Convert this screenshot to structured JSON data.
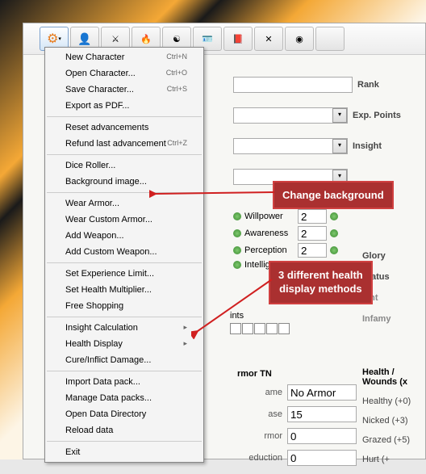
{
  "toolbar": {
    "icons": [
      "gear",
      "char",
      "sword",
      "fire",
      "yinyang",
      "id",
      "ribbon",
      "cross",
      "disc",
      "blank"
    ]
  },
  "menu": {
    "g1": [
      {
        "l": "New Character",
        "s": "Ctrl+N"
      },
      {
        "l": "Open Character...",
        "s": "Ctrl+O"
      },
      {
        "l": "Save Character...",
        "s": "Ctrl+S"
      },
      {
        "l": "Export as PDF...",
        "s": ""
      }
    ],
    "g2": [
      {
        "l": "Reset advancements",
        "s": ""
      },
      {
        "l": "Refund last advancement",
        "s": "Ctrl+Z"
      }
    ],
    "g3": [
      {
        "l": "Dice Roller...",
        "s": ""
      },
      {
        "l": "Background image...",
        "s": ""
      }
    ],
    "g4": [
      {
        "l": "Wear Armor...",
        "s": ""
      },
      {
        "l": "Wear Custom Armor...",
        "s": ""
      },
      {
        "l": "Add Weapon...",
        "s": ""
      },
      {
        "l": "Add Custom Weapon...",
        "s": ""
      }
    ],
    "g5": [
      {
        "l": "Set Experience Limit...",
        "s": ""
      },
      {
        "l": "Set Health Multiplier...",
        "s": ""
      },
      {
        "l": "Free Shopping",
        "s": ""
      }
    ],
    "g6": [
      {
        "l": "Insight Calculation",
        "s": "▸"
      },
      {
        "l": "Health Display",
        "s": "▸"
      },
      {
        "l": "Cure/Inflict Damage...",
        "s": ""
      }
    ],
    "g7": [
      {
        "l": "Import Data pack...",
        "s": ""
      },
      {
        "l": "Manage Data packs...",
        "s": ""
      },
      {
        "l": "Open Data Directory",
        "s": ""
      },
      {
        "l": "Reload data",
        "s": ""
      }
    ],
    "g8": [
      {
        "l": "Exit",
        "s": ""
      }
    ]
  },
  "right": {
    "rank": "Rank",
    "exp": "Exp. Points",
    "insight": "Insight"
  },
  "stats": [
    {
      "n": "Willpower",
      "v": "2"
    },
    {
      "n": "Awareness",
      "v": "2"
    },
    {
      "n": "Perception",
      "v": "2"
    },
    {
      "n": "Intelliger",
      "v": ""
    }
  ],
  "side": {
    "glory": "Glory",
    "status": "Status",
    "taint": "aint",
    "infamy": "Infamy"
  },
  "pts": "ints",
  "armor": {
    "hdr": "rmor TN",
    "name_l": "ame",
    "name_v": "No Armor",
    "base_l": "ase",
    "base_v": "15",
    "armor_l": "rmor",
    "armor_v": "0",
    "red_l": "eduction",
    "red_v": "0"
  },
  "health": {
    "hdr": "Health / Wounds (x",
    "h1": "Healthy (+0)",
    "h2": "Nicked (+3)",
    "h3": "Grazed (+5)",
    "h4": "Hurt (+"
  },
  "call1": "Change background",
  "call2a": "3 different health",
  "call2b": "display methods"
}
